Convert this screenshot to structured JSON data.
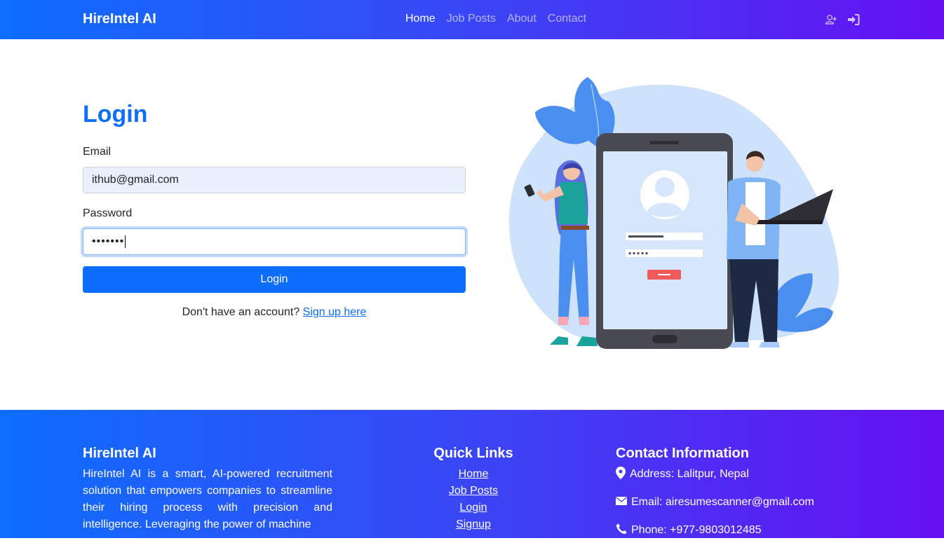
{
  "nav": {
    "brand": "HireIntel AI",
    "links": [
      "Home",
      "Job Posts",
      "About",
      "Contact"
    ],
    "active": "Home",
    "icons": [
      "user-plus-icon",
      "sign-in-icon"
    ]
  },
  "login": {
    "title": "Login",
    "email_label": "Email",
    "email_value": "ithub@gmail.com",
    "password_label": "Password",
    "password_value": "•••••••",
    "button": "Login",
    "signup_prompt": "Don't have an account?",
    "signup_link": "Sign up here"
  },
  "illustration": {
    "colors": {
      "blob": "#cfe2fc",
      "leaf": "#4a8ff0",
      "phone": "#4a4a52",
      "screen": "#d6e6fb",
      "accent": "#f05a5a"
    }
  },
  "footer": {
    "about_title": "HireIntel AI",
    "about_text": "HireIntel AI is a smart, AI-powered recruitment solution that empowers companies to streamline their hiring process with precision and intelligence. Leveraging the power of machine",
    "links_title": "Quick Links",
    "links": [
      "Home",
      "Job Posts",
      "Login",
      "Signup"
    ],
    "contact_title": "Contact Information",
    "address": "Address: Lalitpur, Nepal",
    "email": "Email: airesumescanner@gmail.com",
    "phone": "Phone: +977-9803012485"
  },
  "colors": {
    "primary": "#0d6efd",
    "gradient_end": "#6610f2",
    "input_autofill": "#e8f0fe"
  }
}
